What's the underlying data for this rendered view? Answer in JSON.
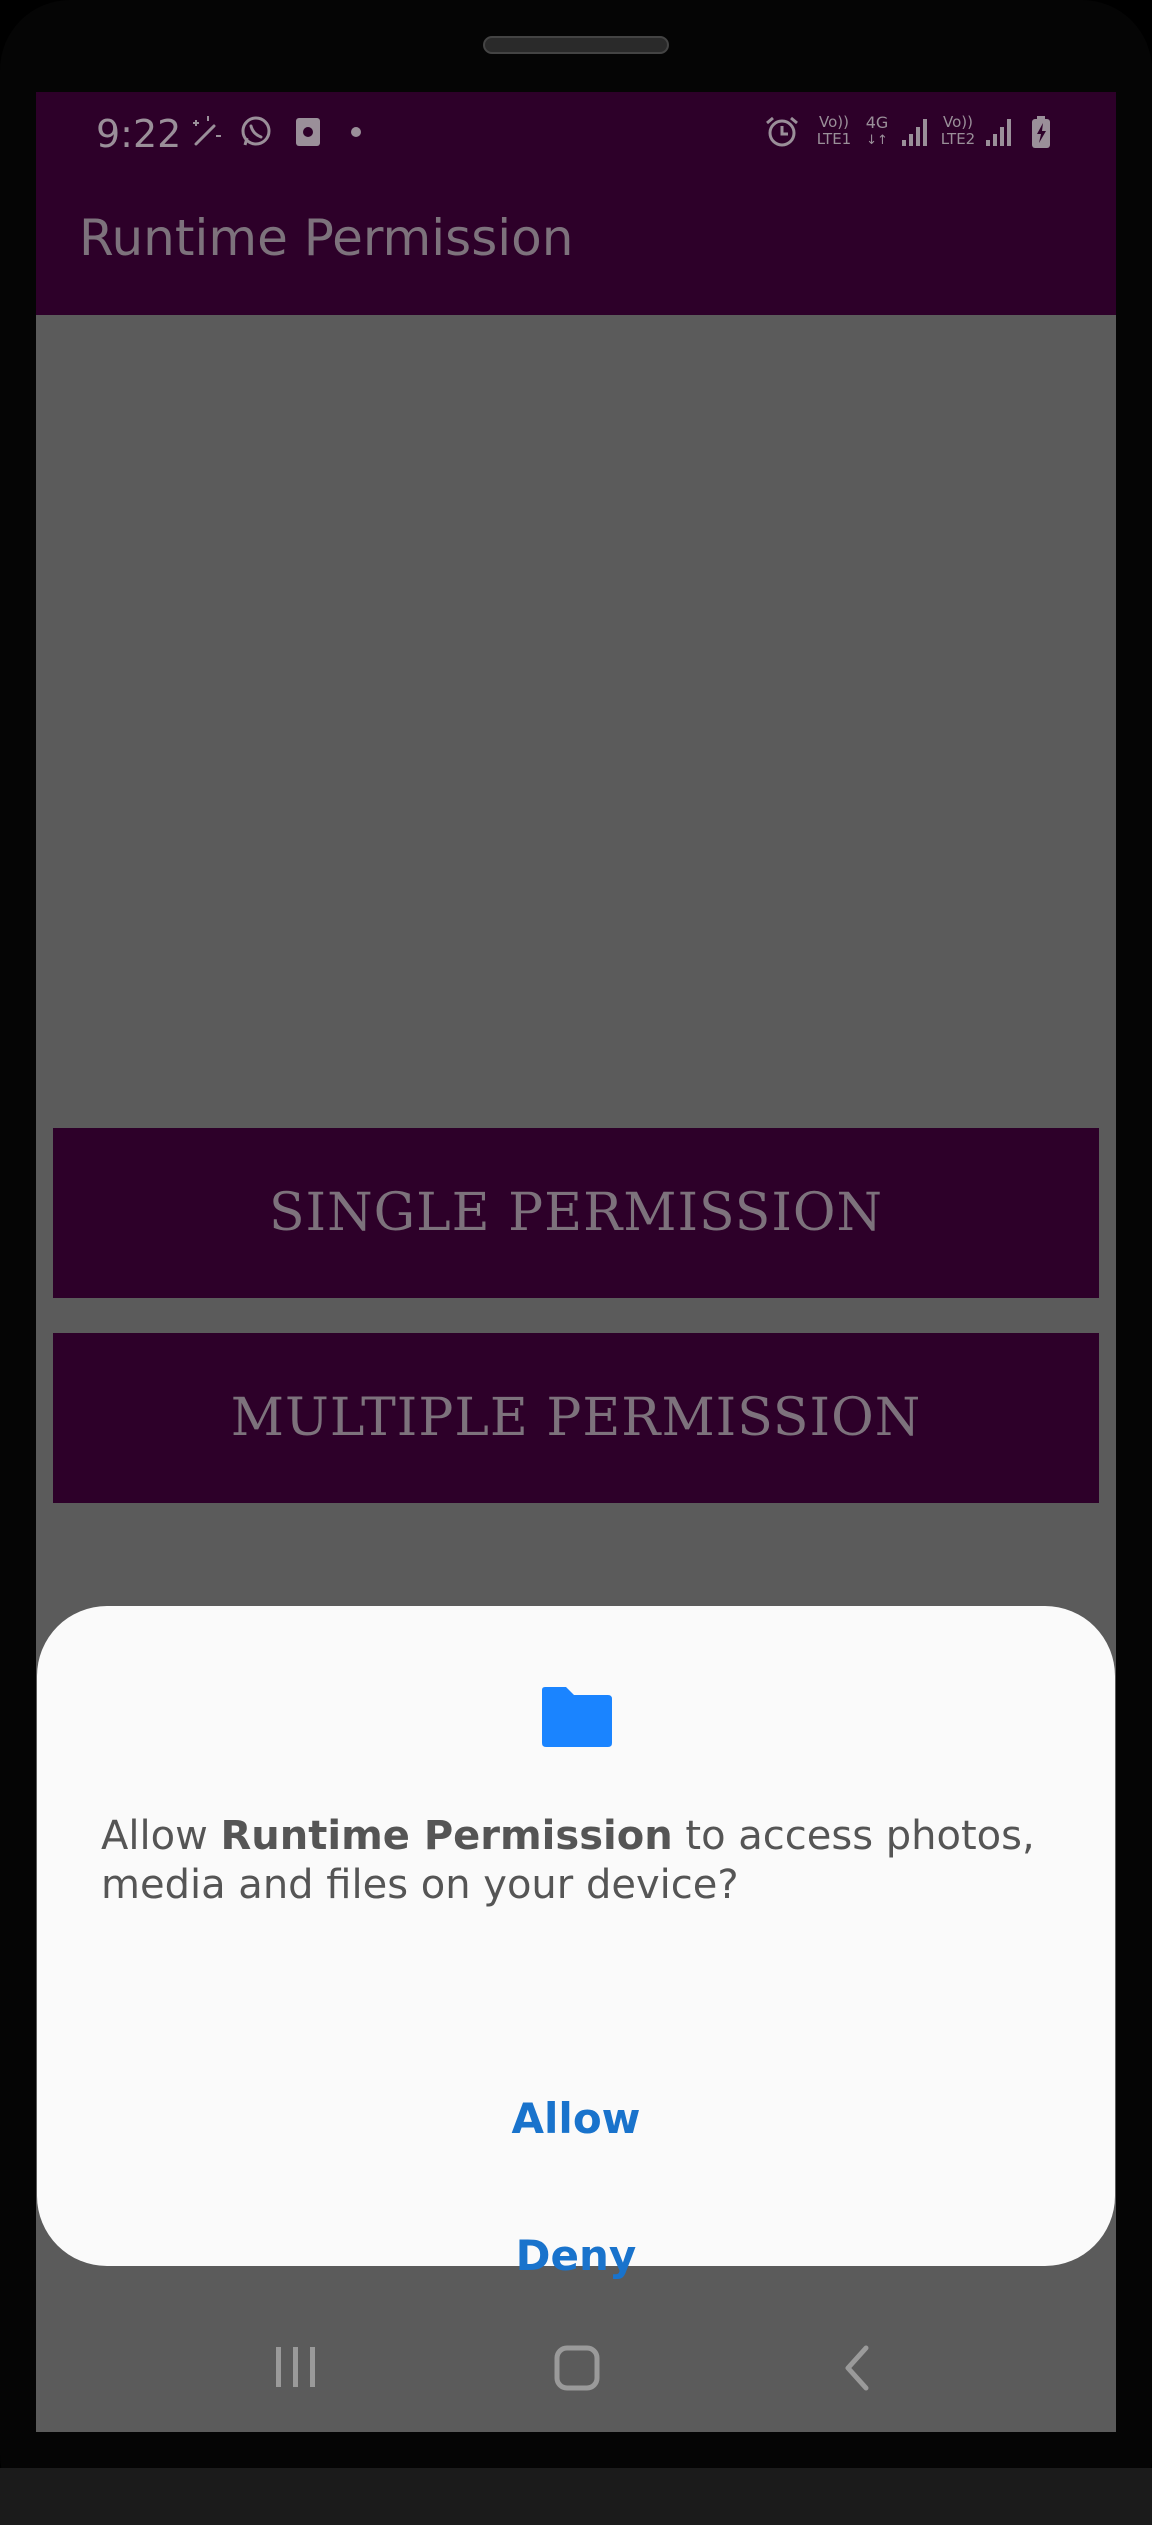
{
  "status_bar": {
    "time": "9:22",
    "sim1_label": "LTE1",
    "sim2_label": "LTE2",
    "volte_label": "Vo))",
    "network_label": "4G",
    "icons": [
      "magic-wand-icon",
      "whatsapp-icon",
      "sim-storage-icon",
      "dot-icon",
      "alarm-icon",
      "signal-icon",
      "signal-icon",
      "battery-charging-icon"
    ]
  },
  "toolbar": {
    "title": "Runtime Permission"
  },
  "buttons": {
    "single_label": "SINGLE PERMISSION",
    "multiple_label": "MULTIPLE PERMISSION"
  },
  "dialog": {
    "icon": "folder-icon",
    "message_prefix": "Allow ",
    "message_app": "Runtime Permission",
    "message_suffix": " to access photos, media and files on your device?",
    "allow_label": "Allow",
    "deny_label": "Deny"
  },
  "nav_bar": {
    "icons": [
      "recents-icon",
      "home-icon",
      "back-icon"
    ]
  },
  "colors": {
    "app_primary": "#2d0029",
    "scrim_background": "#5b5b5b",
    "dialog_background": "#fafafa",
    "dialog_accent": "#1973cc",
    "folder_icon": "#1a84ff"
  }
}
